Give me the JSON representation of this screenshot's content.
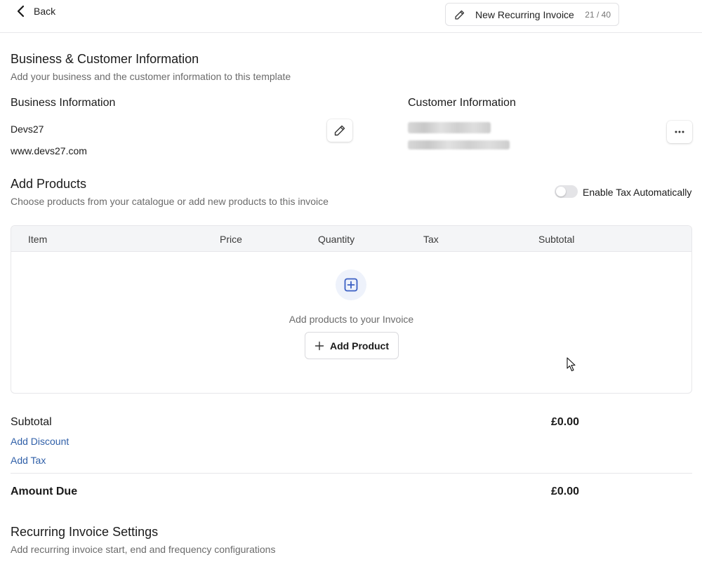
{
  "topbar": {
    "back_label": "Back",
    "title": "New Recurring Invoice",
    "char_count": "21 / 40"
  },
  "business_customer": {
    "heading": "Business & Customer Information",
    "description": "Add your business and the customer information to this template",
    "business": {
      "heading": "Business Information",
      "name": "Devs27",
      "website": "www.devs27.com"
    },
    "customer": {
      "heading": "Customer Information"
    }
  },
  "products": {
    "heading": "Add Products",
    "description": "Choose products from your catalogue or add new products to this invoice",
    "tax_toggle_label": "Enable Tax Automatically",
    "tax_toggle_on": false,
    "columns": [
      "Item",
      "Price",
      "Quantity",
      "Tax",
      "Subtotal"
    ],
    "empty_message": "Add products to your Invoice",
    "add_button": "Add Product"
  },
  "totals": {
    "subtotal_label": "Subtotal",
    "subtotal_value": "£0.00",
    "add_discount": "Add Discount",
    "add_tax": "Add Tax",
    "amount_due_label": "Amount Due",
    "amount_due_value": "£0.00"
  },
  "recurring": {
    "heading": "Recurring Invoice Settings",
    "description": "Add recurring invoice start, end and frequency configurations"
  },
  "colors": {
    "link": "#2f5fa8",
    "accent_icon": "#3b5fc4",
    "table_header_bg": "#f4f5f7"
  },
  "icons": {
    "back": "chevron-left-icon",
    "title_edit": "pencil-icon",
    "business_edit": "pencil-icon",
    "customer_more": "more-horizontal-icon",
    "empty_state": "plus-square-icon",
    "add_product": "plus-icon"
  }
}
